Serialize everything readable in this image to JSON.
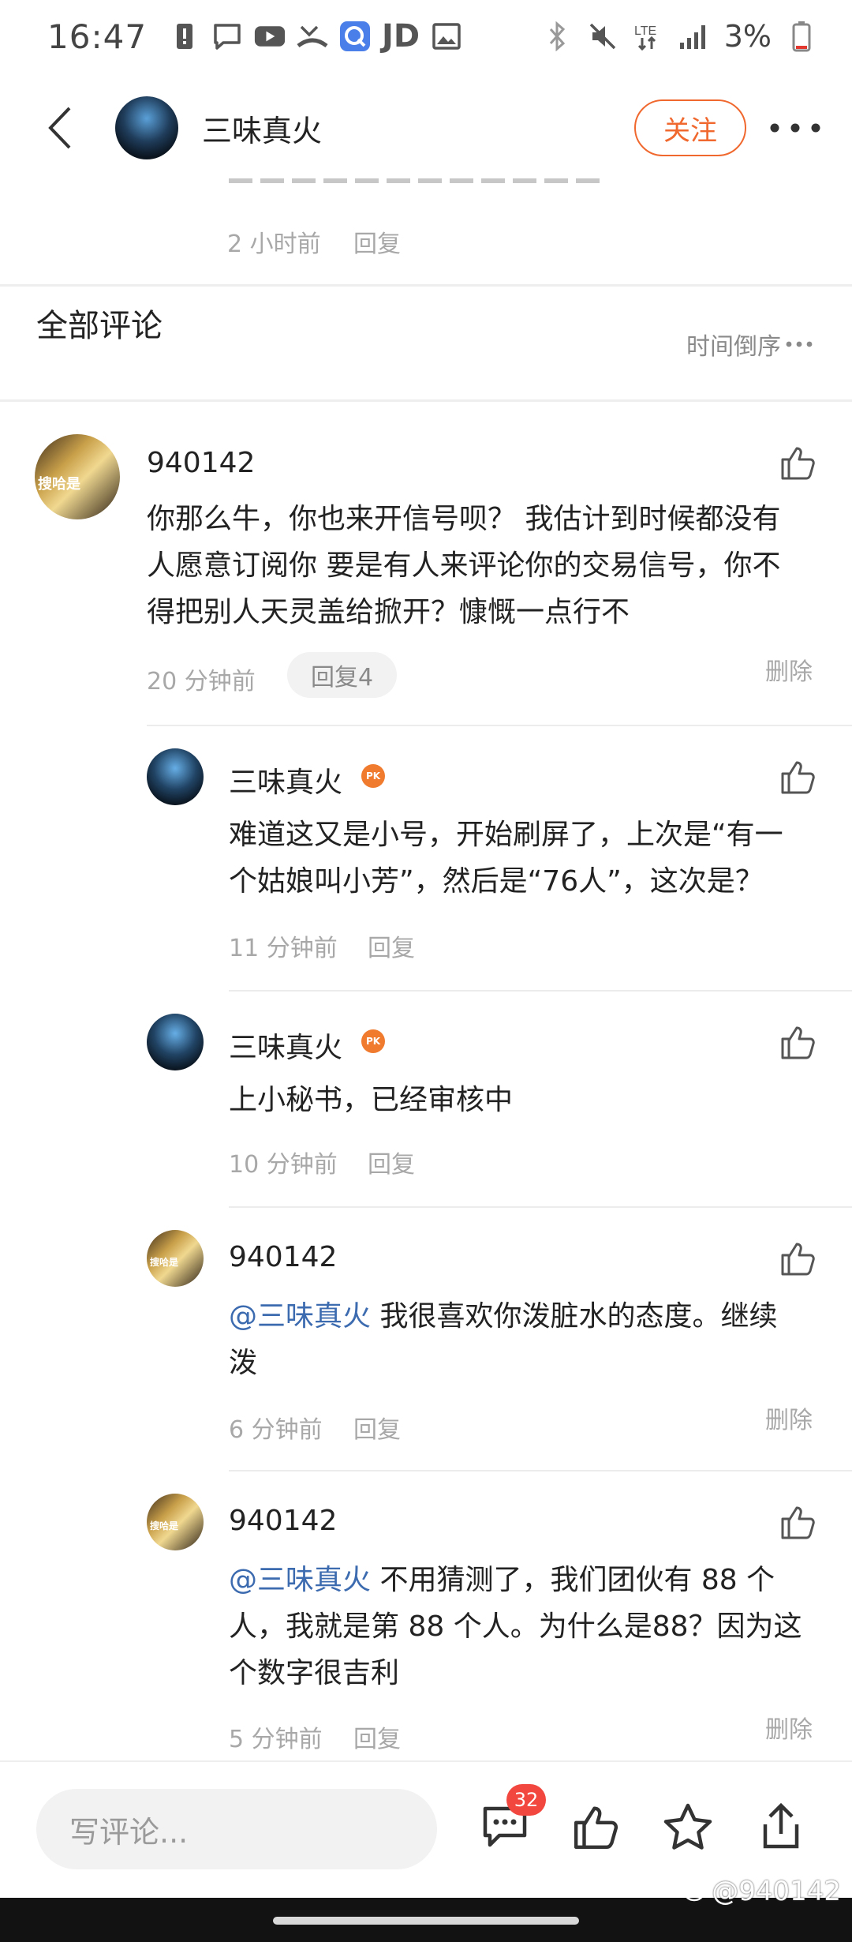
{
  "status_bar": {
    "time": "16:47",
    "jd": "JD",
    "battery": "3%",
    "network": "LTE"
  },
  "header": {
    "name": "三味真火",
    "follow": "关注"
  },
  "prev_comment": {
    "time": "2 小时前",
    "reply": "回复"
  },
  "section": {
    "title": "全部评论",
    "sort": "时间倒序"
  },
  "comments": [
    {
      "user": "940142",
      "text_lines": [
        "你那么牛，你也来开信号呗？ 我估计到时候都没有",
        "人愿意订阅你 要是有人来评论你的交易信号，你不",
        "得把别人天灵盖给掀开？慷慨一点行不"
      ],
      "time": "20 分钟前",
      "reply": "回复4",
      "delete": "删除"
    },
    {
      "user": "三味真火",
      "text_lines": [
        "难道这又是小号，开始刷屏了，上次是“有一",
        "个姑娘叫小芳”，然后是“76人”，这次是？"
      ],
      "time": "11 分钟前",
      "reply": "回复"
    },
    {
      "user": "三味真火",
      "text_lines": [
        "上小秘书，已经审核中"
      ],
      "time": "10 分钟前",
      "reply": "回复"
    },
    {
      "user": "940142",
      "mention": "@三味真火",
      "text_lines": [
        " 我很喜欢你泼脏水的态度。继续",
        "泼"
      ],
      "time": "6 分钟前",
      "reply": "回复",
      "delete": "删除"
    },
    {
      "user": "940142",
      "mention": "@三味真火",
      "text_lines": [
        " 不用猜测了，我们团伙有 88 个",
        "人，我就是第 88 个人。为什么是88？因为这",
        "个数字很吉利"
      ],
      "time": "5 分钟前",
      "reply": "回复",
      "delete": "删除"
    }
  ],
  "avatar_caption": "搜哈是",
  "pk_badge": "PK",
  "bottom": {
    "placeholder": "写评论...",
    "comment_count": "32",
    "watermark": "@940142"
  }
}
